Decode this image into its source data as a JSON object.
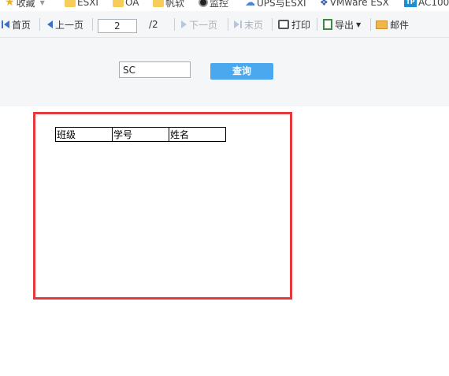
{
  "bookmarks": [
    {
      "icon": "star-icon",
      "label": "收藏"
    },
    {
      "icon": "folder-icon",
      "label": "ESXI"
    },
    {
      "icon": "folder-icon",
      "label": "OA"
    },
    {
      "icon": "folder-icon",
      "label": "帆软"
    },
    {
      "icon": "camera-icon",
      "label": "监控"
    },
    {
      "icon": "cloud-icon",
      "label": "UPS与ESXI"
    },
    {
      "icon": "vmware-icon",
      "label": "VMware ESX"
    },
    {
      "icon": "tp-link-icon",
      "label": "AC100"
    }
  ],
  "toolbar": {
    "first_label": "首页",
    "prev_label": "上一页",
    "page_value": "2",
    "page_total": "/2",
    "next_label": "下一页",
    "last_label": "末页",
    "print_label": "打印",
    "export_label": "导出",
    "mail_label": "邮件"
  },
  "query": {
    "input_value": "SC",
    "button_label": "查询"
  },
  "table": {
    "headers": [
      "班级",
      "学号",
      "姓名"
    ]
  },
  "colors": {
    "highlight": "#e6393e",
    "button": "#4ba8ef",
    "panel": "#f5f6f8"
  }
}
